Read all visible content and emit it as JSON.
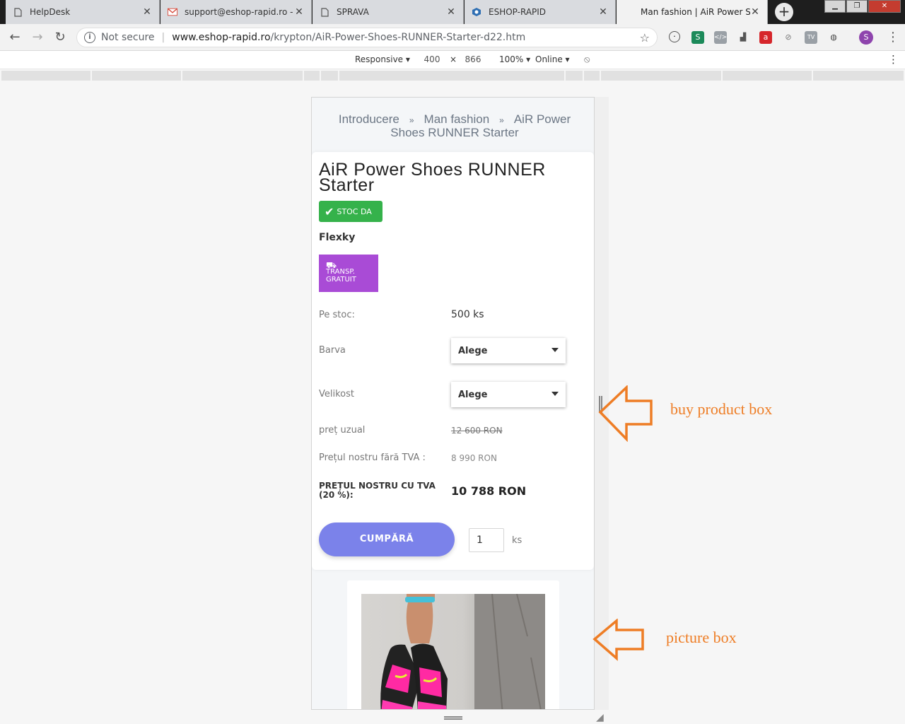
{
  "tabs": [
    {
      "label": "HelpDesk",
      "icon": "page-icon"
    },
    {
      "label": "support@eshop-rapid.ro - M",
      "icon": "gmail-icon"
    },
    {
      "label": "SPRAVA",
      "icon": "page-icon"
    },
    {
      "label": "ESHOP-RAPID",
      "icon": "shield-icon"
    },
    {
      "label": "Man fashion | AiR Power Sho",
      "icon": "none"
    }
  ],
  "address": {
    "security": "Not secure",
    "host": "www.eshop-rapid.ro",
    "path": "/krypton/AiR-Power-Shoes-RUNNER-Starter-d22.htm"
  },
  "devtools": {
    "device": "Responsive",
    "width": "400",
    "times": "×",
    "height": "866",
    "zoom": "100%",
    "network": "Online"
  },
  "profile_initial": "S",
  "breadcrumb": {
    "items": [
      "Introducere",
      "Man fashion",
      "AiR Power Shoes RUNNER Starter"
    ],
    "separator": "»"
  },
  "product": {
    "title": "AiR Power Shoes RUNNER Starter",
    "stock_badge": "STOC DA",
    "brand": "Flexky",
    "shipping_badge": [
      "TRANSP.",
      "GRATUIT"
    ],
    "stock_label": "Pe stoc:",
    "stock_value": "500 ks",
    "color_label": "Barva",
    "color_select": "Alege",
    "size_label": "Velikost",
    "size_select": "Alege",
    "usual_price_label": "preț uzual",
    "usual_price": "12 600 RON",
    "price_no_vat_label": "Prețul nostru fără TVA :",
    "price_no_vat": "8 990 RON",
    "price_vat_label": "PREȚUL NOSTRU CU TVA (20 %):",
    "price_vat": "10 788 RON",
    "buy_label": "CUMPĂRĂ",
    "quantity": "1",
    "quantity_unit": "ks"
  },
  "annotations": {
    "buy_box": "buy product box",
    "picture_box": "picture box"
  },
  "colors": {
    "stock_green": "#35b24b",
    "ship_purple": "#a94bd6",
    "buy_button": "#7b82ea",
    "annotation_orange": "#ee7d25"
  }
}
